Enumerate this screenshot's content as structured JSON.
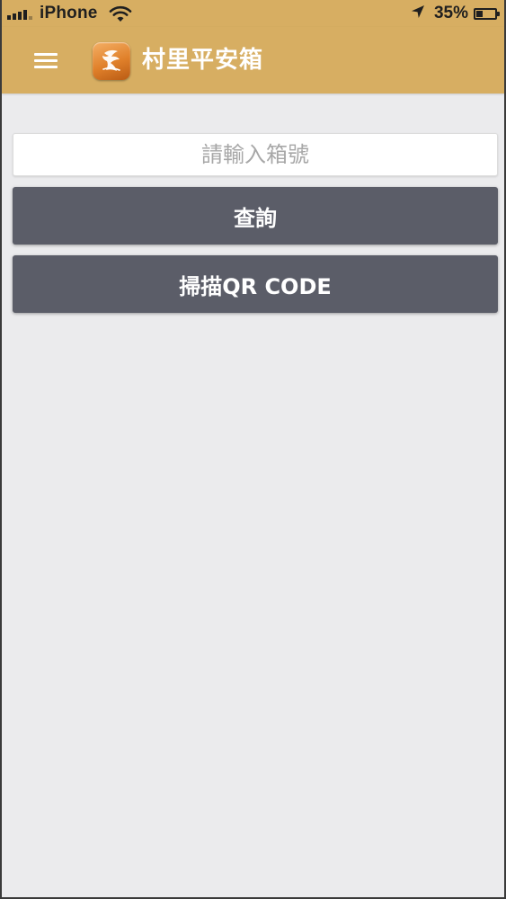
{
  "status_bar": {
    "carrier": "iPhone",
    "battery_percent_text": "35%",
    "battery_level": 0.35,
    "signal_icon": "signal-bars-icon",
    "wifi_icon": "wifi-icon",
    "location_icon": "location-arrow-icon",
    "battery_icon": "battery-icon"
  },
  "app_bar": {
    "title": "村里平安箱",
    "menu_icon": "hamburger-menu-icon",
    "logo_icon": "app-logo-icon"
  },
  "search": {
    "placeholder": "請輸入箱號",
    "value": ""
  },
  "buttons": {
    "query_label": "查詢",
    "scan_label": "掃描QR CODE"
  },
  "colors": {
    "app_bar": "#d7ae62",
    "background": "#ebebed",
    "button": "#5b5d68",
    "button_text": "#ffffff",
    "placeholder": "#a7a7a7"
  }
}
